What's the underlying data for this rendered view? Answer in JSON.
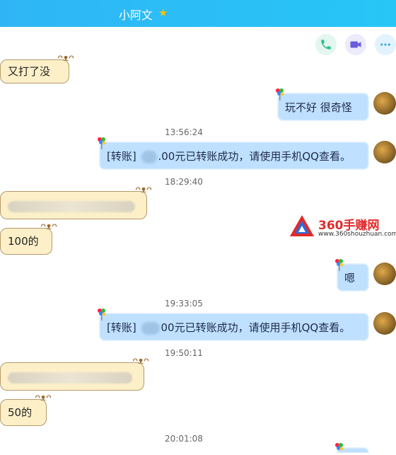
{
  "header": {
    "contact_name": "小阿文",
    "icons": [
      "vip-star-icon",
      "phone-icon",
      "video-icon",
      "more-icon"
    ]
  },
  "watermark": {
    "main": "360手赚网",
    "sub": "www.360shouzhuan.com"
  },
  "messages": [
    {
      "side": "left",
      "text": "又打了没"
    },
    {
      "side": "right",
      "text": "玩不好 很奇怪"
    },
    {
      "time": "13:56:24"
    },
    {
      "side": "right",
      "prefix": "[转账]",
      "text": ".00元已转账成功，请使用手机QQ查看。"
    },
    {
      "time": "18:29:40"
    },
    {
      "side": "left",
      "text": ""
    },
    {
      "side": "left",
      "text": "100的"
    },
    {
      "side": "right",
      "text": "嗯"
    },
    {
      "time": "19:33:05"
    },
    {
      "side": "right",
      "prefix": "[转账]",
      "text": "00元已转账成功，请使用手机QQ查看。"
    },
    {
      "time": "19:50:11"
    },
    {
      "side": "left",
      "text": ""
    },
    {
      "side": "left",
      "text": "50的"
    },
    {
      "time": "20:01:08"
    }
  ],
  "colors": {
    "header": "#2fb5f5",
    "left_bubble": "#fdf0c8",
    "right_bubble": "#bfe0ff",
    "watermark_red": "#e02a2a"
  }
}
